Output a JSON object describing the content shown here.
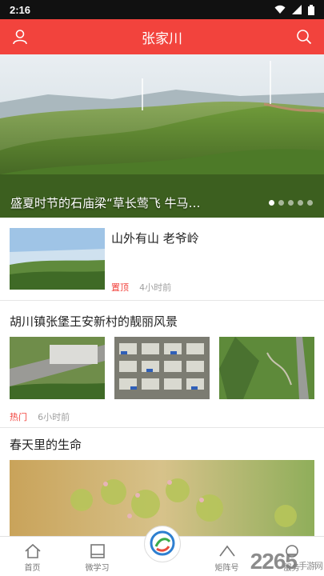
{
  "status_bar": {
    "time": "2:16"
  },
  "app_bar": {
    "title": "张家川"
  },
  "hero": {
    "caption": "盛夏时节的石庙梁“草长莺飞 牛马…",
    "slides": 5,
    "active_slide": 1
  },
  "articles": [
    {
      "title": "山外有山 老爷岭",
      "tag": "置顶",
      "time": "4小时前"
    },
    {
      "title": "胡川镇张堡王安新村的靓丽风景",
      "tag": "热门",
      "time": "6小时前"
    },
    {
      "title": "春天里的生命"
    }
  ],
  "bottom_nav": {
    "items": [
      {
        "label": "首页",
        "icon": "home-icon"
      },
      {
        "label": "微学习",
        "icon": "book-icon"
      },
      {
        "label": "",
        "icon": "logo-icon"
      },
      {
        "label": "矩阵号",
        "icon": "matrix-icon"
      },
      {
        "label": "服务",
        "icon": "service-icon"
      }
    ]
  },
  "watermark": {
    "brand": "2265",
    "suffix": "手游网"
  },
  "colors": {
    "accent": "#f2433d",
    "tag": "#f2433d"
  }
}
